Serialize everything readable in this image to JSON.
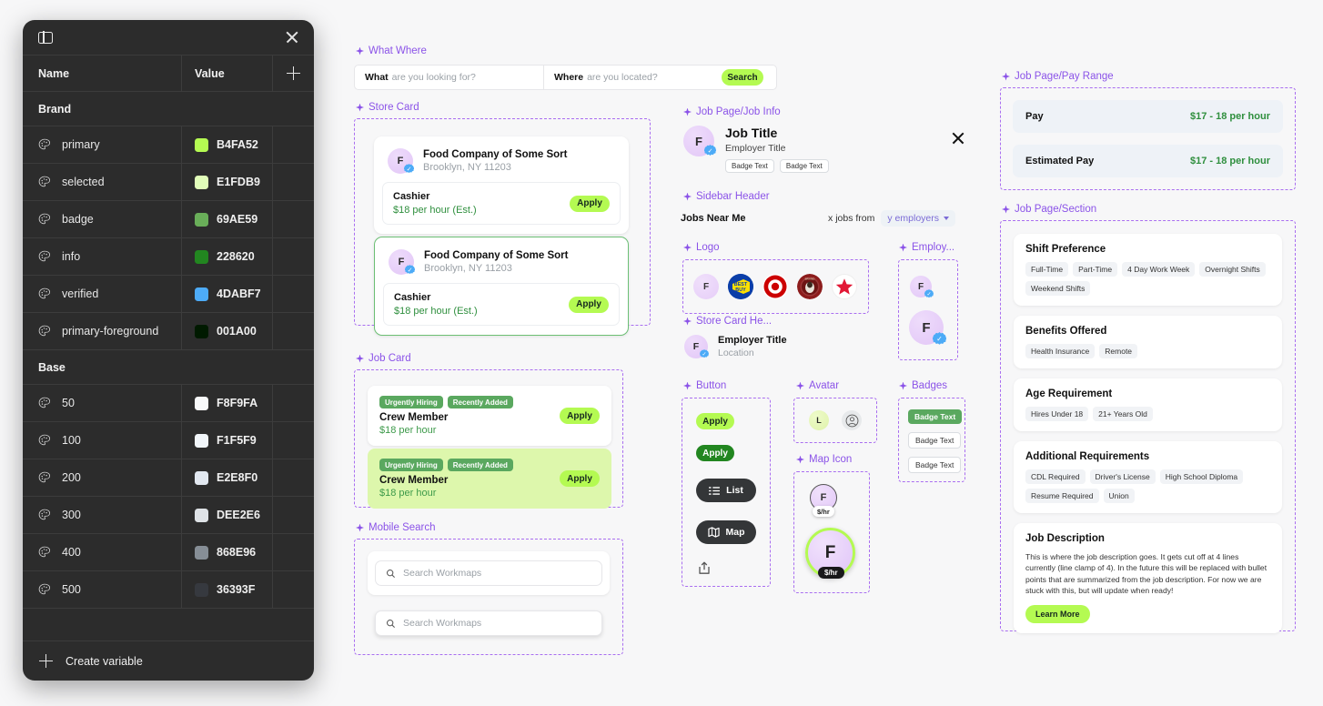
{
  "panel": {
    "layout_icon": "panel-layout-icon",
    "close_icon": "close-icon",
    "col_name": "Name",
    "col_value": "Value",
    "add_icon": "plus-icon",
    "footer_label": "Create variable",
    "groups": [
      {
        "label": "Brand",
        "rows": [
          {
            "name": "primary",
            "value": "B4FA52",
            "color": "#B4FA52"
          },
          {
            "name": "selected",
            "value": "E1FDB9",
            "color": "#E1FDB9"
          },
          {
            "name": "badge",
            "value": "69AE59",
            "color": "#69AE59"
          },
          {
            "name": "info",
            "value": "228620",
            "color": "#228620"
          },
          {
            "name": "verified",
            "value": "4DABF7",
            "color": "#4DABF7"
          },
          {
            "name": "primary-foreground",
            "value": "001A00",
            "color": "#001A00"
          }
        ]
      },
      {
        "label": "Base",
        "rows": [
          {
            "name": "50",
            "value": "F8F9FA",
            "color": "#F8F9FA"
          },
          {
            "name": "100",
            "value": "F1F5F9",
            "color": "#F1F5F9"
          },
          {
            "name": "200",
            "value": "E2E8F0",
            "color": "#E2E8F0"
          },
          {
            "name": "300",
            "value": "DEE2E6",
            "color": "#DEE2E6"
          },
          {
            "name": "400",
            "value": "868E96",
            "color": "#868E96"
          },
          {
            "name": "500",
            "value": "36393F",
            "color": "#36393F"
          }
        ]
      }
    ]
  },
  "sections": {
    "what_where": "What Where",
    "store_card": "Store Card",
    "job_card": "Job Card",
    "mobile_search": "Mobile Search",
    "job_info": "Job Page/Job Info",
    "sidebar_header": "Sidebar Header",
    "logo": "Logo",
    "store_card_header": "Store Card He...",
    "button": "Button",
    "avatar": "Avatar",
    "map_icon": "Map Icon",
    "employer": "Employ...",
    "badges": "Badges",
    "pay_range": "Job Page/Pay Range",
    "job_section": "Job Page/Section"
  },
  "what_where": {
    "what_label": "What",
    "what_placeholder": "are you looking for?",
    "where_label": "Where",
    "where_placeholder": "are you located?",
    "search_button": "Search"
  },
  "store_card": {
    "cards": [
      {
        "initial": "F",
        "company": "Food Company of Some Sort",
        "location": "Brooklyn, NY 11203",
        "role": "Cashier",
        "pay": "$18 per hour (Est.)",
        "apply": "Apply",
        "selected": false
      },
      {
        "initial": "F",
        "company": "Food Company of Some Sort",
        "location": "Brooklyn, NY 11203",
        "role": "Cashier",
        "pay": "$18 per hour (Est.)",
        "apply": "Apply",
        "selected": true
      }
    ]
  },
  "job_card": {
    "cards": [
      {
        "badge1": "Urgently Hiring",
        "badge2": "Recently Added",
        "title": "Crew Member",
        "pay": "$18 per hour",
        "apply": "Apply",
        "variant": "white"
      },
      {
        "badge1": "Urgently Hiring",
        "badge2": "Recently Added",
        "title": "Crew Member",
        "pay": "$18 per hour",
        "apply": "Apply",
        "variant": "green"
      }
    ]
  },
  "mobile_search": {
    "placeholder_1": "Search Workmaps",
    "placeholder_2": "Search Workmaps",
    "search_icon": "search-icon"
  },
  "job_info": {
    "initial": "F",
    "title": "Job Title",
    "employer": "Employer Title",
    "badge_1": "Badge Text",
    "badge_2": "Badge Text",
    "close_icon": "close-icon"
  },
  "sidebar_header": {
    "title": "Jobs Near Me",
    "count_text": "x jobs from",
    "select_value": "y employers"
  },
  "logo": {
    "items": [
      "F",
      "BEST BUY",
      "Target",
      "Coffee Brand",
      "Macy's Star"
    ]
  },
  "store_card_header": {
    "initial": "F",
    "title": "Employer Title",
    "subtitle": "Location"
  },
  "button": {
    "apply_primary": "Apply",
    "apply_dark": "Apply",
    "list": "List",
    "map": "Map",
    "share_icon": "share-icon",
    "list_icon": "list-icon",
    "map_icon": "map-icon"
  },
  "avatar": {
    "letter": "L",
    "person_icon": "person-circle-icon"
  },
  "map_icon": {
    "small_initial": "F",
    "small_label": "$/hr",
    "large_initial": "F",
    "large_label": "$/hr"
  },
  "employer": {
    "small_initial": "F",
    "large_initial": "F"
  },
  "badges": {
    "items": [
      {
        "text": "Badge Text",
        "style": "solid"
      },
      {
        "text": "Badge Text",
        "style": "outline"
      },
      {
        "text": "Badge Text",
        "style": "outline"
      }
    ]
  },
  "pay_range": {
    "rows": [
      {
        "label": "Pay",
        "value": "$17 - 18 per hour"
      },
      {
        "label": "Estimated Pay",
        "value": "$17 - 18 per hour"
      }
    ]
  },
  "job_section": {
    "shift": {
      "title": "Shift Preference",
      "tags": [
        "Full-Time",
        "Part-Time",
        "4 Day Work Week",
        "Overnight Shifts",
        "Weekend Shifts"
      ]
    },
    "benefits": {
      "title": "Benefits Offered",
      "tags": [
        "Health Insurance",
        "Remote"
      ]
    },
    "age": {
      "title": "Age Requirement",
      "tags": [
        "Hires Under 18",
        "21+ Years Old"
      ]
    },
    "requirements": {
      "title": "Additional Requirements",
      "tags": [
        "CDL Required",
        "Driver's License",
        "High School Diploma",
        "Resume Required",
        "Union"
      ]
    },
    "description": {
      "title": "Job Description",
      "body": "This is where the job description goes. It gets cut off at 4 lines currently (line clamp of 4). In the future this will be replaced with bullet points that are summarized from the job description. For now we are stuck with this, but will update when ready!",
      "button": "Learn More"
    }
  },
  "colors": {
    "primary": "#B4FA52",
    "selected": "#E1FDB9",
    "badge": "#69AE59",
    "info": "#228620",
    "verified": "#4DABF7",
    "primary_foreground": "#001A00",
    "section_label": "#8B53E8"
  }
}
